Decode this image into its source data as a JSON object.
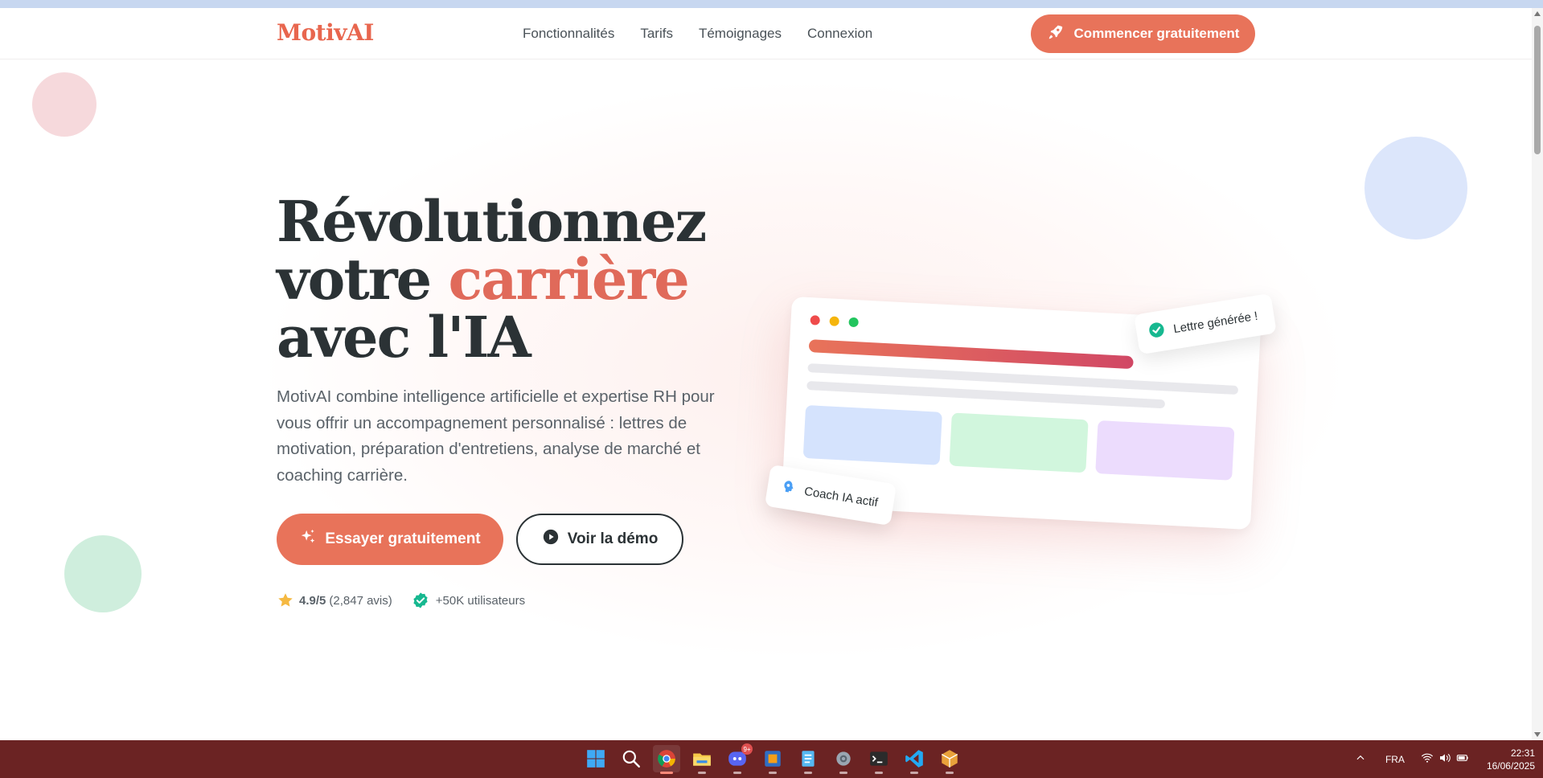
{
  "header": {
    "logo": "MotivAI",
    "nav": [
      "Fonctionnalités",
      "Tarifs",
      "Témoignages",
      "Connexion"
    ],
    "cta_label": "Commencer gratuitement",
    "cta_icon": "rocket-icon"
  },
  "hero": {
    "title_part1": "Révolutionnez votre ",
    "title_accent": "carrière",
    "title_part2": " avec l'IA",
    "description": "MotivAI combine intelligence artificielle et expertise RH pour vous offrir un accompagnement personnalisé : lettres de motivation, préparation d'entretiens, analyse de marché et coaching carrière.",
    "primary_button": "Essayer gratuitement",
    "secondary_button": "Voir la démo",
    "rating_value": "4.9/5",
    "rating_reviews": "(2,847 avis)",
    "users": "+50K utilisateurs"
  },
  "mockup": {
    "badge_letter": "Lettre générée !",
    "badge_coach": "Coach IA actif"
  },
  "taskbar": {
    "apps": [
      "windows-start",
      "search",
      "chrome",
      "file-explorer",
      "discord",
      "virtualbox",
      "notepad",
      "settings",
      "terminal",
      "vscode",
      "package-app"
    ],
    "discord_badge": "9+",
    "language": "FRA",
    "time": "22:31",
    "date": "16/06/2025"
  },
  "colors": {
    "brand": "#e8735a",
    "accent_text": "#e06a5a",
    "dark": "#2b3235",
    "taskbar": "#6b2323"
  }
}
